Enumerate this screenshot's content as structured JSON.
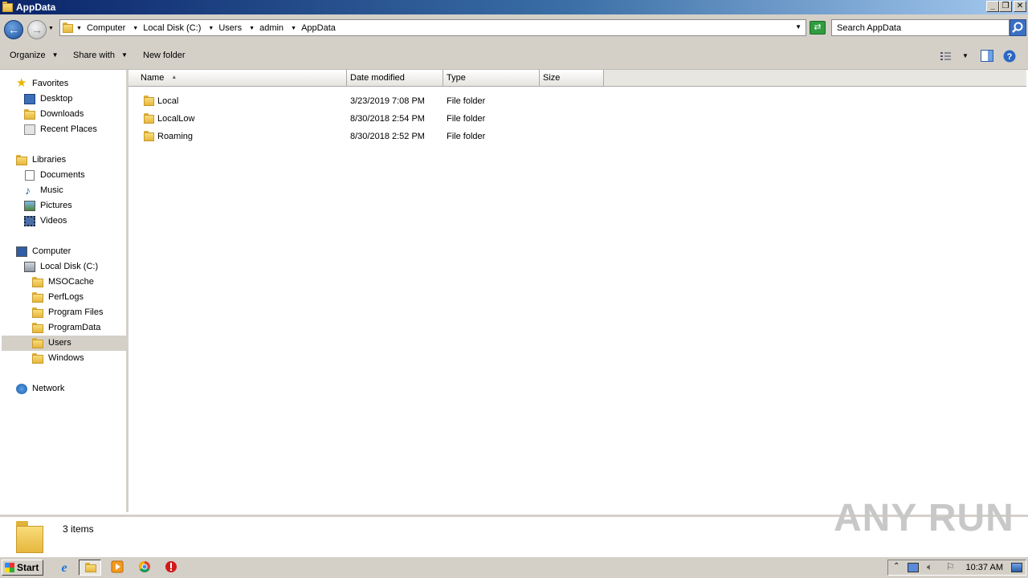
{
  "window": {
    "title": "AppData",
    "buttons": {
      "minimize": "_",
      "maximize": "❐",
      "close": "✕"
    }
  },
  "address": {
    "crumbs": [
      "Computer",
      "Local Disk (C:)",
      "Users",
      "admin",
      "AppData"
    ],
    "search_placeholder": "Search AppData"
  },
  "toolbar": {
    "organize": "Organize",
    "share_with": "Share with",
    "new_folder": "New folder"
  },
  "nav": {
    "favorites": {
      "label": "Favorites",
      "items": [
        "Desktop",
        "Downloads",
        "Recent Places"
      ]
    },
    "libraries": {
      "label": "Libraries",
      "items": [
        "Documents",
        "Music",
        "Pictures",
        "Videos"
      ]
    },
    "computer": {
      "label": "Computer",
      "drive": "Local Disk (C:)",
      "folders": [
        "MSOCache",
        "PerfLogs",
        "Program Files",
        "ProgramData",
        "Users",
        "Windows"
      ],
      "selected": "Users"
    },
    "network": {
      "label": "Network"
    }
  },
  "columns": [
    "Name",
    "Date modified",
    "Type",
    "Size"
  ],
  "files": [
    {
      "name": "Local",
      "date": "3/23/2019 7:08 PM",
      "type": "File folder",
      "size": ""
    },
    {
      "name": "LocalLow",
      "date": "8/30/2018 2:54 PM",
      "type": "File folder",
      "size": ""
    },
    {
      "name": "Roaming",
      "date": "8/30/2018 2:52 PM",
      "type": "File folder",
      "size": ""
    }
  ],
  "status": {
    "item_count": "3 items"
  },
  "watermark": "ANY RUN",
  "taskbar": {
    "start": "Start",
    "clock": "10:37 AM"
  },
  "colors": {
    "titlebar": "#0a246a",
    "chrome": "#d4d0c8",
    "folder": "#f0c850",
    "selection": "#d4d0c8"
  }
}
